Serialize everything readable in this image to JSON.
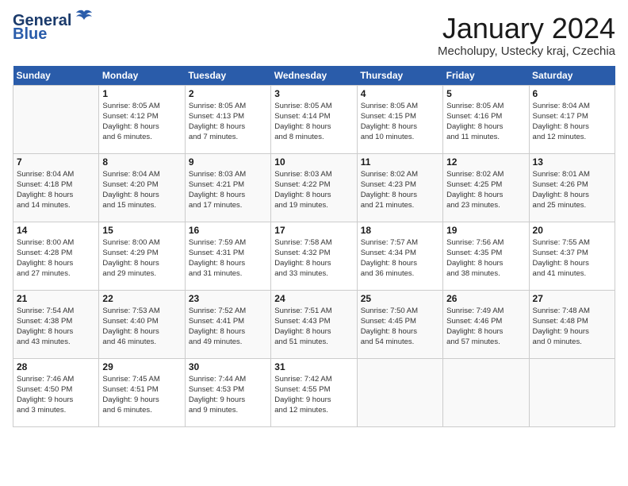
{
  "header": {
    "logo_line1": "General",
    "logo_line2": "Blue",
    "title": "January 2024",
    "subtitle": "Mecholupy, Ustecky kraj, Czechia"
  },
  "days_of_week": [
    "Sunday",
    "Monday",
    "Tuesday",
    "Wednesday",
    "Thursday",
    "Friday",
    "Saturday"
  ],
  "weeks": [
    [
      {
        "day": "",
        "info": ""
      },
      {
        "day": "1",
        "info": "Sunrise: 8:05 AM\nSunset: 4:12 PM\nDaylight: 8 hours\nand 6 minutes."
      },
      {
        "day": "2",
        "info": "Sunrise: 8:05 AM\nSunset: 4:13 PM\nDaylight: 8 hours\nand 7 minutes."
      },
      {
        "day": "3",
        "info": "Sunrise: 8:05 AM\nSunset: 4:14 PM\nDaylight: 8 hours\nand 8 minutes."
      },
      {
        "day": "4",
        "info": "Sunrise: 8:05 AM\nSunset: 4:15 PM\nDaylight: 8 hours\nand 10 minutes."
      },
      {
        "day": "5",
        "info": "Sunrise: 8:05 AM\nSunset: 4:16 PM\nDaylight: 8 hours\nand 11 minutes."
      },
      {
        "day": "6",
        "info": "Sunrise: 8:04 AM\nSunset: 4:17 PM\nDaylight: 8 hours\nand 12 minutes."
      }
    ],
    [
      {
        "day": "7",
        "info": "Sunrise: 8:04 AM\nSunset: 4:18 PM\nDaylight: 8 hours\nand 14 minutes."
      },
      {
        "day": "8",
        "info": "Sunrise: 8:04 AM\nSunset: 4:20 PM\nDaylight: 8 hours\nand 15 minutes."
      },
      {
        "day": "9",
        "info": "Sunrise: 8:03 AM\nSunset: 4:21 PM\nDaylight: 8 hours\nand 17 minutes."
      },
      {
        "day": "10",
        "info": "Sunrise: 8:03 AM\nSunset: 4:22 PM\nDaylight: 8 hours\nand 19 minutes."
      },
      {
        "day": "11",
        "info": "Sunrise: 8:02 AM\nSunset: 4:23 PM\nDaylight: 8 hours\nand 21 minutes."
      },
      {
        "day": "12",
        "info": "Sunrise: 8:02 AM\nSunset: 4:25 PM\nDaylight: 8 hours\nand 23 minutes."
      },
      {
        "day": "13",
        "info": "Sunrise: 8:01 AM\nSunset: 4:26 PM\nDaylight: 8 hours\nand 25 minutes."
      }
    ],
    [
      {
        "day": "14",
        "info": "Sunrise: 8:00 AM\nSunset: 4:28 PM\nDaylight: 8 hours\nand 27 minutes."
      },
      {
        "day": "15",
        "info": "Sunrise: 8:00 AM\nSunset: 4:29 PM\nDaylight: 8 hours\nand 29 minutes."
      },
      {
        "day": "16",
        "info": "Sunrise: 7:59 AM\nSunset: 4:31 PM\nDaylight: 8 hours\nand 31 minutes."
      },
      {
        "day": "17",
        "info": "Sunrise: 7:58 AM\nSunset: 4:32 PM\nDaylight: 8 hours\nand 33 minutes."
      },
      {
        "day": "18",
        "info": "Sunrise: 7:57 AM\nSunset: 4:34 PM\nDaylight: 8 hours\nand 36 minutes."
      },
      {
        "day": "19",
        "info": "Sunrise: 7:56 AM\nSunset: 4:35 PM\nDaylight: 8 hours\nand 38 minutes."
      },
      {
        "day": "20",
        "info": "Sunrise: 7:55 AM\nSunset: 4:37 PM\nDaylight: 8 hours\nand 41 minutes."
      }
    ],
    [
      {
        "day": "21",
        "info": "Sunrise: 7:54 AM\nSunset: 4:38 PM\nDaylight: 8 hours\nand 43 minutes."
      },
      {
        "day": "22",
        "info": "Sunrise: 7:53 AM\nSunset: 4:40 PM\nDaylight: 8 hours\nand 46 minutes."
      },
      {
        "day": "23",
        "info": "Sunrise: 7:52 AM\nSunset: 4:41 PM\nDaylight: 8 hours\nand 49 minutes."
      },
      {
        "day": "24",
        "info": "Sunrise: 7:51 AM\nSunset: 4:43 PM\nDaylight: 8 hours\nand 51 minutes."
      },
      {
        "day": "25",
        "info": "Sunrise: 7:50 AM\nSunset: 4:45 PM\nDaylight: 8 hours\nand 54 minutes."
      },
      {
        "day": "26",
        "info": "Sunrise: 7:49 AM\nSunset: 4:46 PM\nDaylight: 8 hours\nand 57 minutes."
      },
      {
        "day": "27",
        "info": "Sunrise: 7:48 AM\nSunset: 4:48 PM\nDaylight: 9 hours\nand 0 minutes."
      }
    ],
    [
      {
        "day": "28",
        "info": "Sunrise: 7:46 AM\nSunset: 4:50 PM\nDaylight: 9 hours\nand 3 minutes."
      },
      {
        "day": "29",
        "info": "Sunrise: 7:45 AM\nSunset: 4:51 PM\nDaylight: 9 hours\nand 6 minutes."
      },
      {
        "day": "30",
        "info": "Sunrise: 7:44 AM\nSunset: 4:53 PM\nDaylight: 9 hours\nand 9 minutes."
      },
      {
        "day": "31",
        "info": "Sunrise: 7:42 AM\nSunset: 4:55 PM\nDaylight: 9 hours\nand 12 minutes."
      },
      {
        "day": "",
        "info": ""
      },
      {
        "day": "",
        "info": ""
      },
      {
        "day": "",
        "info": ""
      }
    ]
  ]
}
